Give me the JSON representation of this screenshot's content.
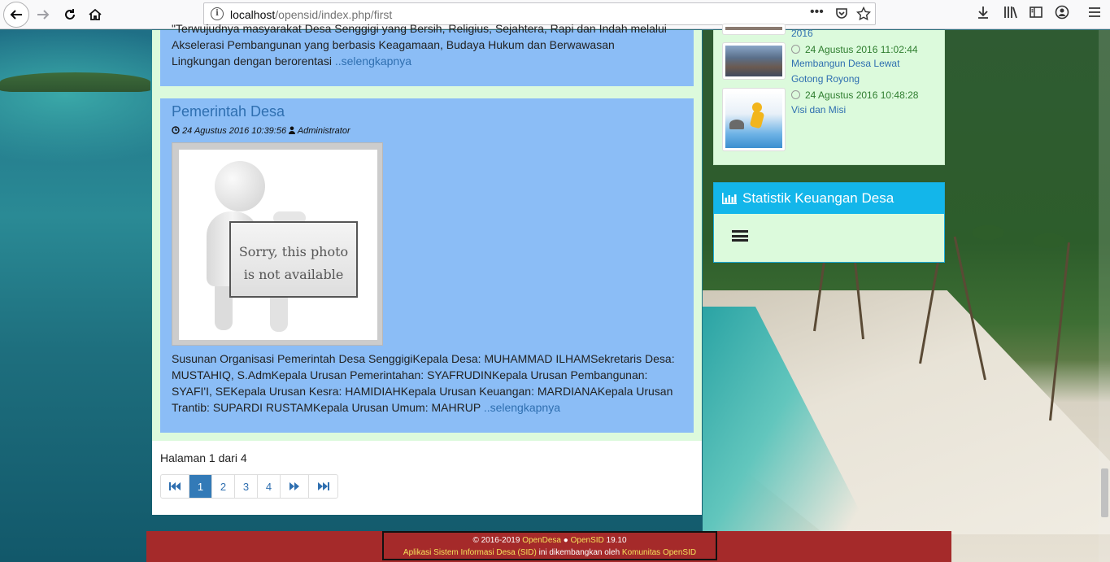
{
  "browser": {
    "url_host": "localhost",
    "url_path": "/opensid/index.php/first"
  },
  "article1": {
    "excerpt_line1": "\"Terwujudnya masyarakat Desa Senggigi yang Bersih, Religius, Sejahtera, Rapi dan Indah melalui",
    "excerpt_line2": "Akselerasi Pembangunan yang berbasis Keagamaan, Budaya Hukum dan Berwawasan",
    "excerpt_line3": "Lingkungan dengan berorentasi",
    "more": "..selengkapnya"
  },
  "article2": {
    "title": "Pemerintah Desa",
    "date": "24 Agustus 2016 10:39:56",
    "author": "Administrator",
    "photo_line1": "Sorry, this photo",
    "photo_line2": "is not available",
    "excerpt": "Susunan Organisasi Pemerintah Desa SenggigiKepala Desa: MUHAMMAD ILHAMSekretaris Desa: MUSTAHIQ, S.AdmKepala Urusan Pemerintahan: SYAFRUDINKepala Urusan Pembangunan: SYAFI'I, SEKepala Urusan Kesra: HAMIDIAHKepala Urusan Keuangan: MARDIANAKepala Urusan Trantib: SUPARDI RUSTAMKepala Urusan Umum: MAHRUP",
    "more": "..selengkapnya"
  },
  "pagination": {
    "summary": "Halaman 1 dari 4",
    "pages": [
      "1",
      "2",
      "3",
      "4"
    ],
    "current": "1"
  },
  "sidebar": {
    "news": [
      {
        "date": "",
        "title": "2016"
      },
      {
        "date": "24 Agustus 2016 11:02:44",
        "title": "Membangun Desa Lewat Gotong Royong"
      },
      {
        "date": "24 Agustus 2016 10:48:28",
        "title": "Visi dan Misi"
      }
    ],
    "finance_title": "Statistik Keuangan Desa"
  },
  "footer": {
    "copyright": "© 2016-2019",
    "brand1": "OpenDesa",
    "brand2": "OpenSID",
    "version": "19.10",
    "line2_link1": "Aplikasi Sistem Informasi Desa (SID)",
    "line2_mid": " ini dikembangkan oleh ",
    "line2_link2": "Komunitas OpenSID"
  },
  "colors": {
    "card_bg": "#8bbdf6",
    "panel_green": "#dcfadc",
    "link": "#2f6fb0",
    "widget_header": "#13b6ea",
    "footer_bg": "#a52a2a"
  }
}
